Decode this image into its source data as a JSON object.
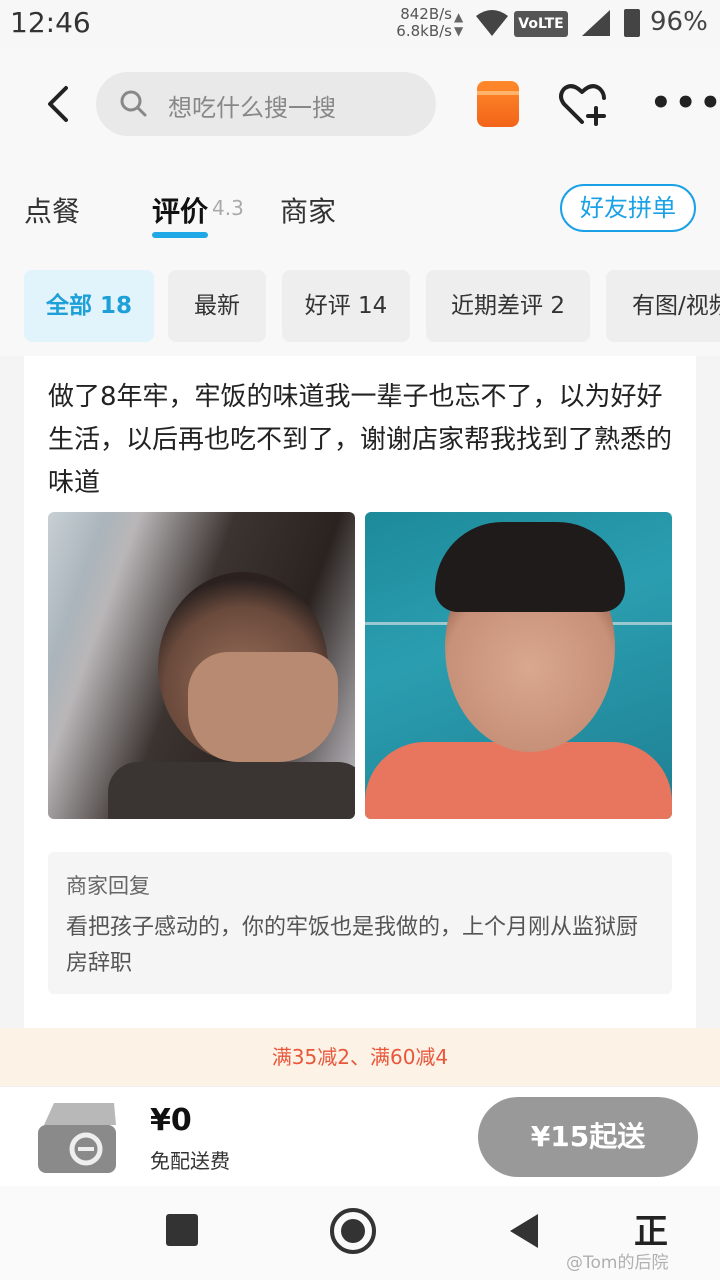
{
  "status_bar": {
    "time": "12:46",
    "net_up": "842B/s",
    "net_down": "6.8kB/s",
    "volte": "VoLTE",
    "battery": "96%"
  },
  "header": {
    "search_placeholder": "想吃什么搜一搜",
    "icons": [
      "back-arrow-icon",
      "search-icon",
      "red-packet-icon",
      "heart-plus-icon",
      "more-icon"
    ]
  },
  "tabs": {
    "items": [
      {
        "label": "点餐"
      },
      {
        "label": "评价",
        "rating": "4.3",
        "active": true
      },
      {
        "label": "商家"
      }
    ],
    "friend_button": "好友拼单",
    "accent": "#20a8e6"
  },
  "filters": [
    {
      "label": "全部 18",
      "active": true
    },
    {
      "label": "最新"
    },
    {
      "label": "好评 14"
    },
    {
      "label": "近期差评 2"
    },
    {
      "label": "有图/视频"
    }
  ],
  "review": {
    "text": "做了8年牢，牢饭的味道我一辈子也忘不了，以为好好生活，以后再也吃不到了，谢谢店家帮我找到了熟悉的味道",
    "photos": [
      "photo-man-covering-face",
      "photo-man-crying"
    ],
    "reply": {
      "title": "商家回复",
      "text": "看把孩子感动的，你的牢饭也是我做的，上个月刚从监狱厨房辞职"
    }
  },
  "promo": {
    "text": "满35减2、满60减4",
    "color": "#e8573b"
  },
  "checkout": {
    "price": "¥0",
    "delivery": "免配送费",
    "order_button": "¥15起送"
  },
  "navbar": {
    "ime_label": "正",
    "watermark": "@Tom的后院"
  }
}
